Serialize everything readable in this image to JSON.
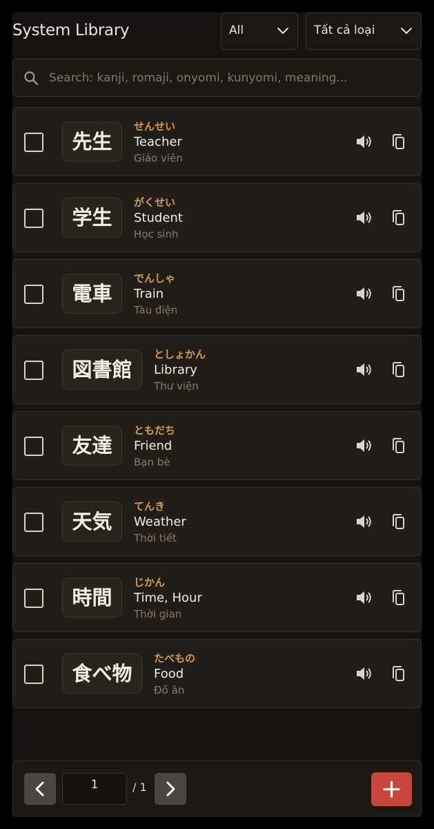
{
  "header": {
    "title": "System Library",
    "level_filter": {
      "selected": "All"
    },
    "type_filter": {
      "selected": "Tất cả loại"
    }
  },
  "search": {
    "placeholder": "Search: kanji, romaji, onyomi, kunyomi, meaning..."
  },
  "colors": {
    "background": "#171310",
    "card": "#221d18",
    "reading_accent": "#cf9d5a",
    "add_button": "#c8453b"
  },
  "words": [
    {
      "kanji": "先生",
      "reading": "せんせい",
      "meaning": "Teacher",
      "translation": "Giáo viên"
    },
    {
      "kanji": "学生",
      "reading": "がくせい",
      "meaning": "Student",
      "translation": "Học sinh"
    },
    {
      "kanji": "電車",
      "reading": "でんしゃ",
      "meaning": "Train",
      "translation": "Tàu điện"
    },
    {
      "kanji": "図書館",
      "reading": "としょかん",
      "meaning": "Library",
      "translation": "Thư viện"
    },
    {
      "kanji": "友達",
      "reading": "ともだち",
      "meaning": "Friend",
      "translation": "Bạn bè"
    },
    {
      "kanji": "天気",
      "reading": "てんき",
      "meaning": "Weather",
      "translation": "Thời tiết"
    },
    {
      "kanji": "時間",
      "reading": "じかん",
      "meaning": "Time, Hour",
      "translation": "Thời gian"
    },
    {
      "kanji": "食べ物",
      "reading": "たべもの",
      "meaning": "Food",
      "translation": "Đồ ăn"
    }
  ],
  "icons": {
    "search": "search-icon",
    "chevron": "chevron-down-icon",
    "speaker": "speaker-icon",
    "copy": "copy-icon",
    "prev": "chevron-left-icon",
    "next": "chevron-right-icon",
    "add": "plus-icon"
  },
  "pagination": {
    "current_page": "1",
    "total_label": "/ 1"
  }
}
